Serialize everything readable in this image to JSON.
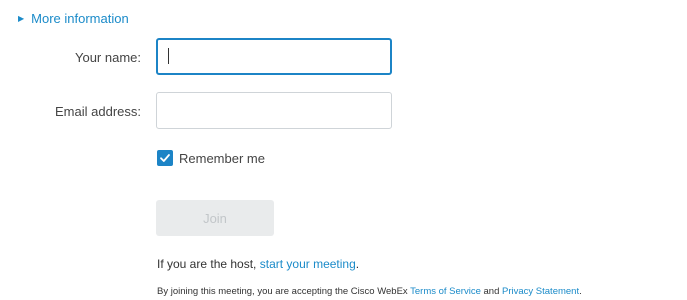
{
  "more_info": {
    "label": "More information",
    "caret_icon": "caret-right-icon"
  },
  "form": {
    "name_label": "Your name:",
    "name_value": "",
    "email_label": "Email address:",
    "email_value": "",
    "remember_label": "Remember me",
    "remember_checked": true,
    "join_label": "Join",
    "join_enabled": false
  },
  "host": {
    "prefix": "If you are the host, ",
    "link": "start your meeting",
    "suffix": "."
  },
  "legal": {
    "prefix": "By joining this meeting, you are accepting the Cisco WebEx ",
    "terms_link": "Terms of Service",
    "middle": " and ",
    "privacy_link": "Privacy Statement",
    "suffix": "."
  },
  "colors": {
    "accent": "#1c84c6",
    "link": "#1b8bc9",
    "disabled_button_bg": "#e9ebec",
    "disabled_button_text": "#c2c6c9"
  }
}
